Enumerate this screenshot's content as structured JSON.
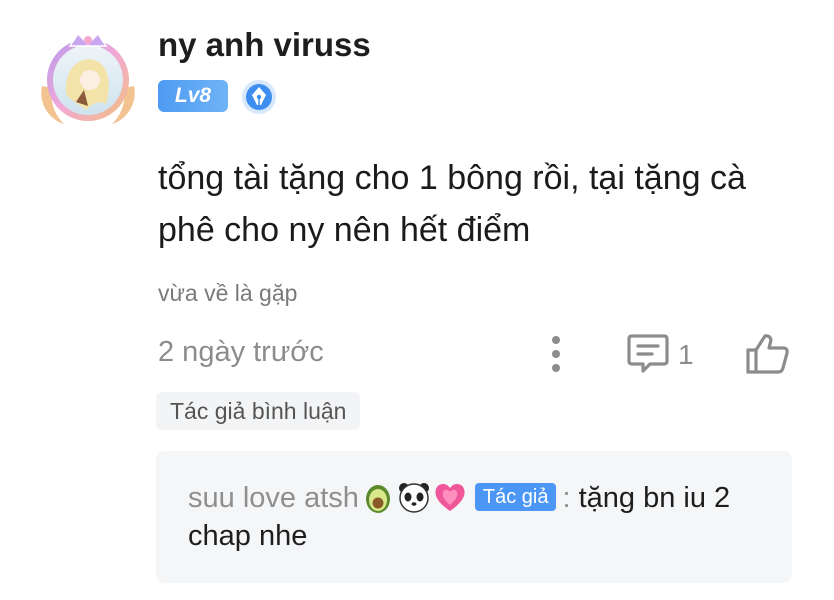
{
  "comment": {
    "username": "ny anh viruss",
    "level": "Lv8",
    "text": "tổng tài tặng cho 1 bông rồi, tại tặng cà phê cho ny nên hết điểm",
    "subtitle": "vừa về là gặp",
    "timestamp": "2 ngày trước",
    "reply_count": "1",
    "tag": "Tác giả bình luận"
  },
  "reply": {
    "author": "suu love atsh",
    "author_tag": "Tác giả",
    "separator": ":",
    "text": "tặng bn iu 2 chap nhe",
    "emojis": [
      "avocado-icon",
      "panda-icon",
      "heart-icon"
    ]
  },
  "colors": {
    "accent_blue": "#4c97f5",
    "muted_text": "#8c8c8c",
    "reply_background": "#f5f6f8",
    "chip_background": "#f3f4f6"
  },
  "icons": [
    "avatar-frame",
    "pen-nib-medal-icon",
    "more-vertical-icon",
    "comment-icon",
    "thumbs-up-icon"
  ]
}
